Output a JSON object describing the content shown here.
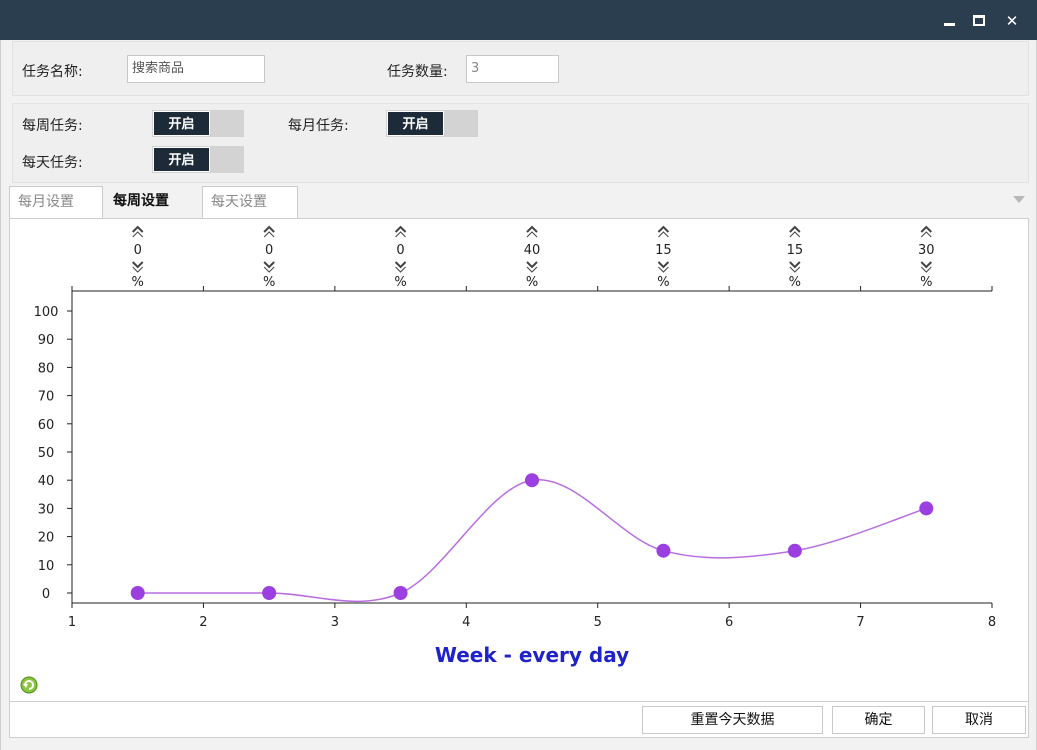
{
  "window": {
    "title": "",
    "controls": [
      "minimize-icon",
      "maximize-icon",
      "close-icon"
    ]
  },
  "task": {
    "name_label": "任务名称:",
    "name_value": "搜索商品",
    "count_label": "任务数量:",
    "count_value": "3"
  },
  "switches": {
    "weekly_label": "每周任务:",
    "weekly_state": "开启",
    "monthly_label": "每月任务:",
    "monthly_state": "开启",
    "daily_label": "每天任务:",
    "daily_state": "开启"
  },
  "tabs": [
    {
      "label": "每月设置",
      "active": false
    },
    {
      "label": "每周设置",
      "active": true
    },
    {
      "label": "每天设置",
      "active": false
    }
  ],
  "chart_data": {
    "type": "line",
    "xlabel": "Week - every day",
    "ylabel": "",
    "title": "",
    "x": [
      1.5,
      2.5,
      3.5,
      4.5,
      5.5,
      6.5,
      7.5
    ],
    "values": [
      0,
      0,
      0,
      40,
      15,
      15,
      30
    ],
    "value_unit": "%",
    "xlim": [
      1,
      8
    ],
    "ylim": [
      0,
      100
    ],
    "xticks": [
      "1",
      "2",
      "3",
      "4",
      "5",
      "6",
      "7",
      "8"
    ],
    "yticks": [
      "0",
      "10",
      "20",
      "30",
      "40",
      "50",
      "60",
      "70",
      "80",
      "90",
      "100"
    ],
    "line_color": "#b86de0",
    "point_color": "#9b3fe0",
    "xlabel_color": "#1f22c9",
    "grid": false,
    "smooth": true
  },
  "footer": {
    "reset_label": "重置今天数据",
    "ok_label": "确定",
    "cancel_label": "取消"
  },
  "icons": {
    "refresh": "refresh-icon",
    "up": "chevron-up-icon",
    "down": "chevron-down-icon",
    "dropdown": "dropdown-arrow-icon"
  }
}
